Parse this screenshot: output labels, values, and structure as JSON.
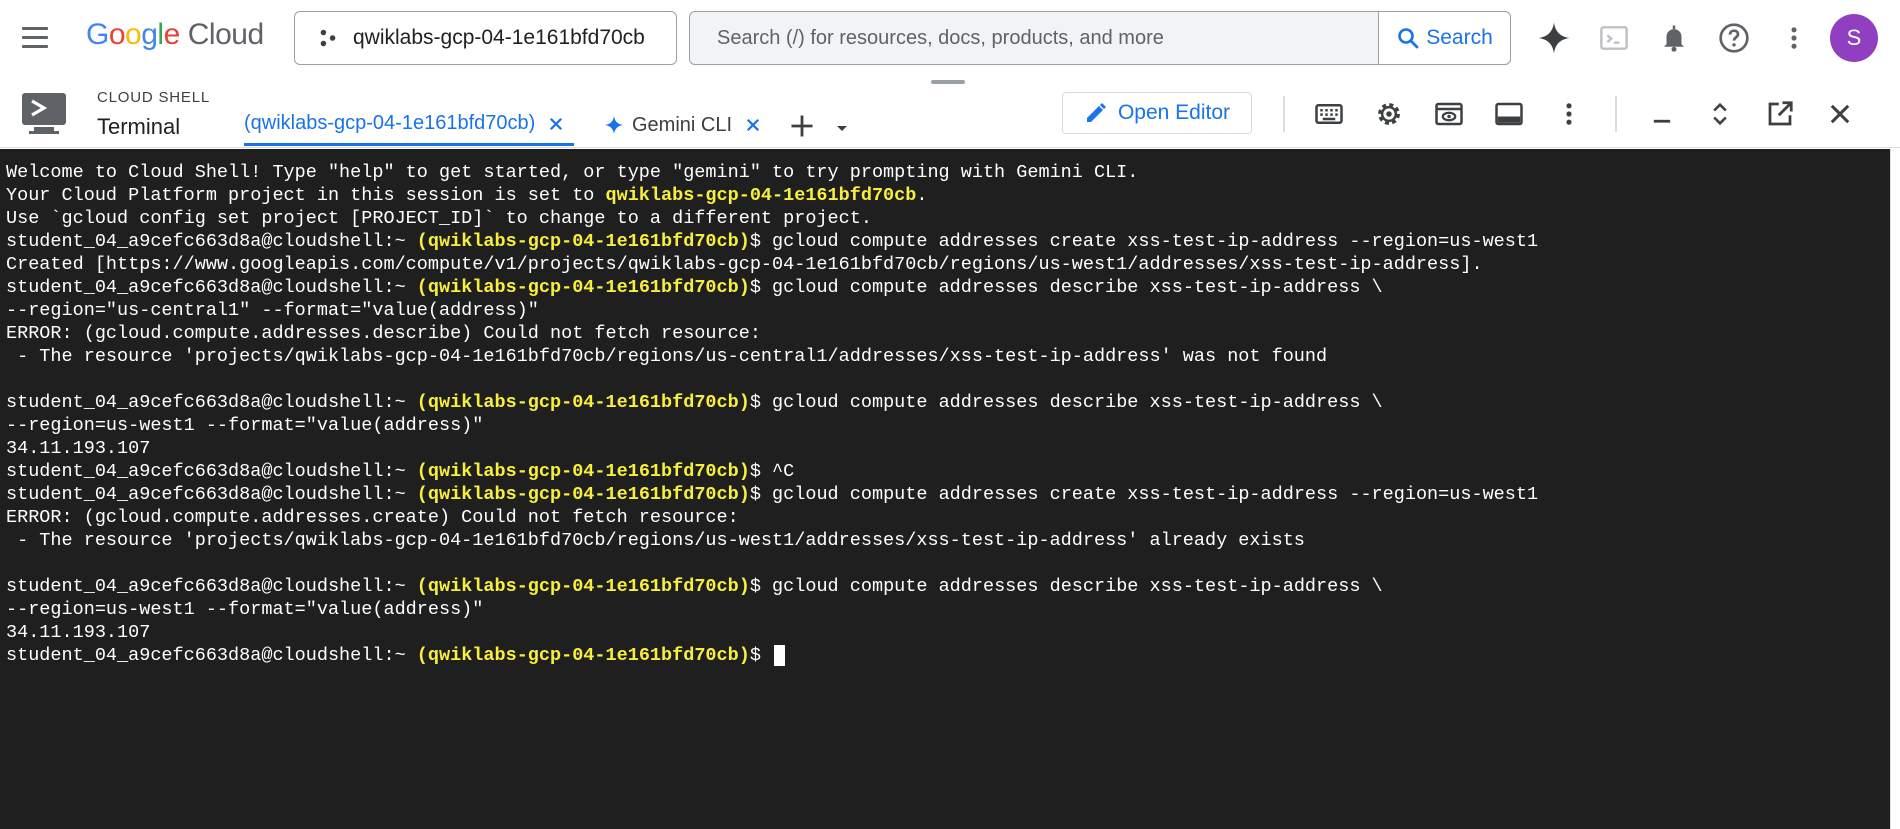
{
  "header": {
    "logo": {
      "g1": "G",
      "o1": "o",
      "o2": "o",
      "g2": "g",
      "l": "l",
      "e": "e",
      "cloud": "Cloud"
    },
    "project": "qwiklabs-gcp-04-1e161bfd70cb",
    "search_placeholder": "Search (/) for resources, docs, products, and more",
    "search_button": "Search",
    "avatar_initial": "S"
  },
  "shell": {
    "kicker": "CLOUD SHELL",
    "title": "Terminal",
    "tabs": [
      {
        "label": "(qwiklabs-gcp-04-1e161bfd70cb)",
        "active": true
      },
      {
        "label": "Gemini CLI",
        "active": false
      }
    ],
    "open_editor": "Open Editor"
  },
  "terminal": {
    "lines": [
      {
        "text": "Welcome to Cloud Shell! Type \"help\" to get started, or type \"gemini\" to try prompting with Gemini CLI."
      },
      {
        "pre": "Your Cloud Platform project in this session is set to ",
        "hl": "qwiklabs-gcp-04-1e161bfd70cb",
        "post": "."
      },
      {
        "text": "Use `gcloud config set project [PROJECT_ID]` to change to a different project."
      },
      {
        "pre": "student_04_a9cefc663d8a@cloudshell:~ ",
        "hl": "(qwiklabs-gcp-04-1e161bfd70cb)",
        "post": "$ gcloud compute addresses create xss-test-ip-address --region=us-west1"
      },
      {
        "text": "Created [https://www.googleapis.com/compute/v1/projects/qwiklabs-gcp-04-1e161bfd70cb/regions/us-west1/addresses/xss-test-ip-address]."
      },
      {
        "pre": "student_04_a9cefc663d8a@cloudshell:~ ",
        "hl": "(qwiklabs-gcp-04-1e161bfd70cb)",
        "post": "$ gcloud compute addresses describe xss-test-ip-address \\"
      },
      {
        "text": "--region=\"us-central1\" --format=\"value(address)\""
      },
      {
        "text": "ERROR: (gcloud.compute.addresses.describe) Could not fetch resource:"
      },
      {
        "text": " - The resource 'projects/qwiklabs-gcp-04-1e161bfd70cb/regions/us-central1/addresses/xss-test-ip-address' was not found"
      },
      {
        "text": ""
      },
      {
        "pre": "student_04_a9cefc663d8a@cloudshell:~ ",
        "hl": "(qwiklabs-gcp-04-1e161bfd70cb)",
        "post": "$ gcloud compute addresses describe xss-test-ip-address \\"
      },
      {
        "text": "--region=us-west1 --format=\"value(address)\""
      },
      {
        "text": "34.11.193.107"
      },
      {
        "pre": "student_04_a9cefc663d8a@cloudshell:~ ",
        "hl": "(qwiklabs-gcp-04-1e161bfd70cb)",
        "post": "$ ^C"
      },
      {
        "pre": "student_04_a9cefc663d8a@cloudshell:~ ",
        "hl": "(qwiklabs-gcp-04-1e161bfd70cb)",
        "post": "$ gcloud compute addresses create xss-test-ip-address --region=us-west1"
      },
      {
        "text": "ERROR: (gcloud.compute.addresses.create) Could not fetch resource:"
      },
      {
        "text": " - The resource 'projects/qwiklabs-gcp-04-1e161bfd70cb/regions/us-west1/addresses/xss-test-ip-address' already exists"
      },
      {
        "text": ""
      },
      {
        "pre": "student_04_a9cefc663d8a@cloudshell:~ ",
        "hl": "(qwiklabs-gcp-04-1e161bfd70cb)",
        "post": "$ gcloud compute addresses describe xss-test-ip-address \\"
      },
      {
        "text": "--region=us-west1 --format=\"value(address)\""
      },
      {
        "text": "34.11.193.107"
      },
      {
        "pre": "student_04_a9cefc663d8a@cloudshell:~ ",
        "hl": "(qwiklabs-gcp-04-1e161bfd70cb)",
        "post": "$ ",
        "cursor": true
      }
    ]
  },
  "colors": {
    "accent": "#1a73e8",
    "terminal_bg": "#1f1f1f",
    "terminal_fg": "#ffffff",
    "project_highlight": "#f7ef3c",
    "avatar": "#8f3fbf"
  },
  "icons": [
    "menu-icon",
    "project-icon",
    "search-icon",
    "gemini-sparkle-icon",
    "cloud-shell-icon",
    "notifications-icon",
    "help-icon",
    "more-vert-icon",
    "terminal-icon",
    "close-icon",
    "add-icon",
    "dropdown-icon",
    "pencil-icon",
    "keyboard-icon",
    "settings-icon",
    "web-preview-icon",
    "panel-icon",
    "minimize-icon",
    "maximize-icon",
    "open-new-window-icon"
  ]
}
